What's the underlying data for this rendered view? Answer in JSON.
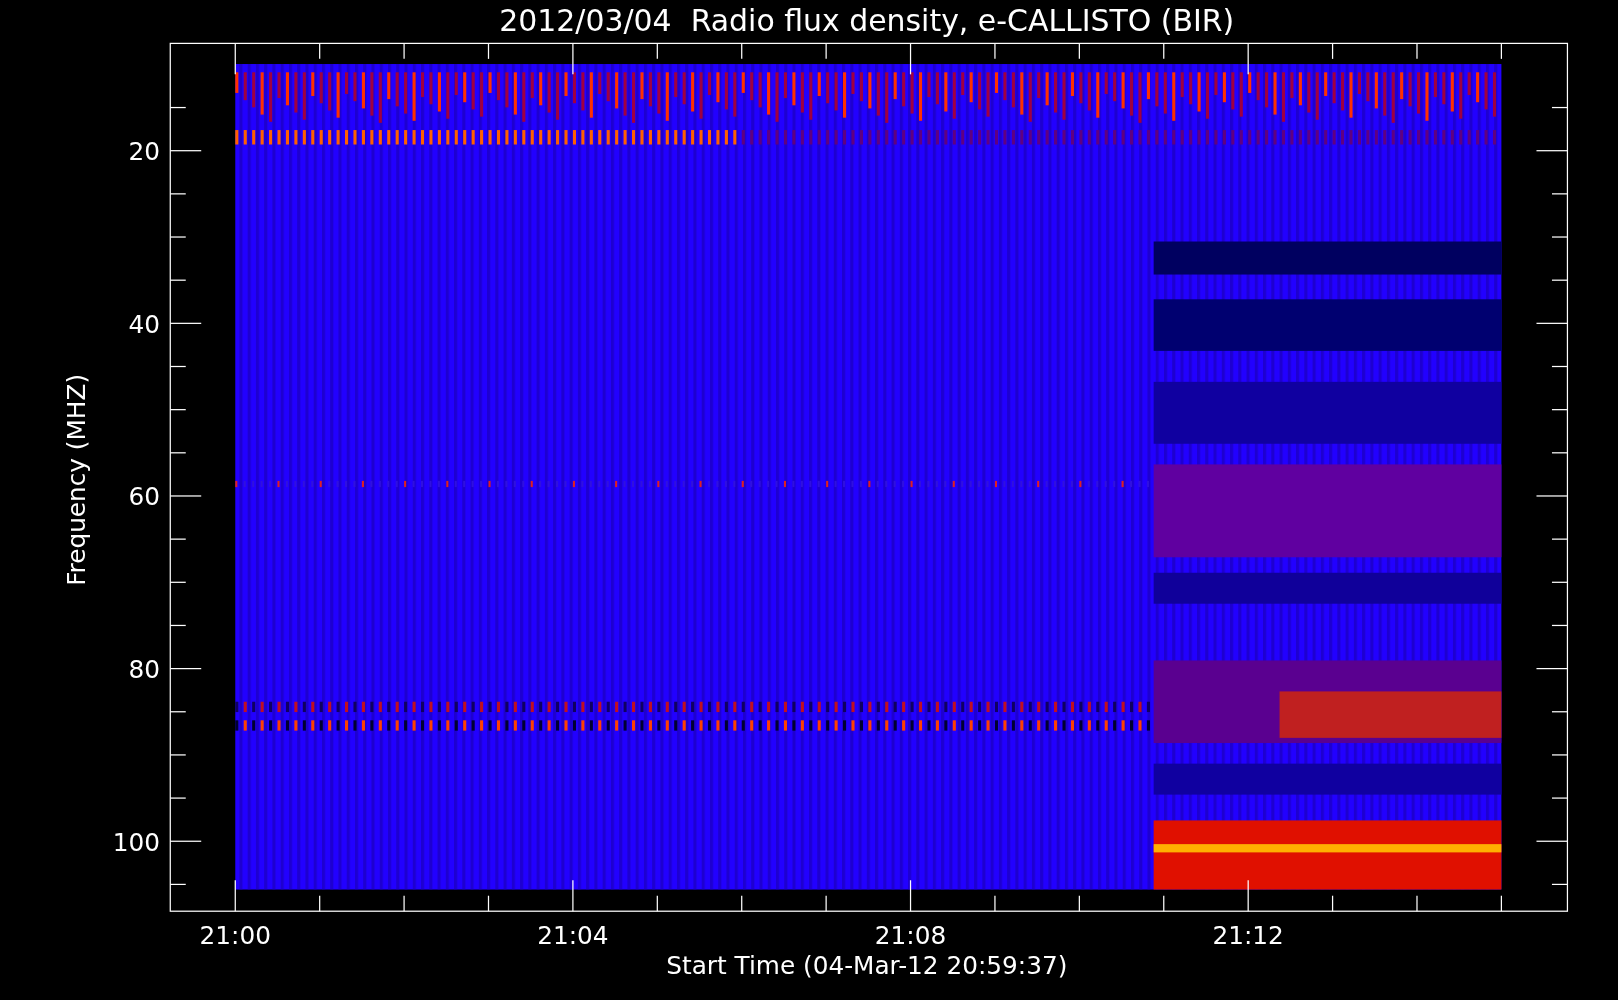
{
  "title": "2012/03/04  Radio flux density, e-CALLISTO (BIR)",
  "y_axis": {
    "label": "Frequency (MHZ)",
    "ticks": [
      "20",
      "40",
      "60",
      "80",
      "100"
    ]
  },
  "x_axis": {
    "label": "Start Time (04-Mar-12 20:59:37)",
    "ticks": [
      "21:00",
      "21:04",
      "21:08",
      "21:12"
    ]
  }
}
